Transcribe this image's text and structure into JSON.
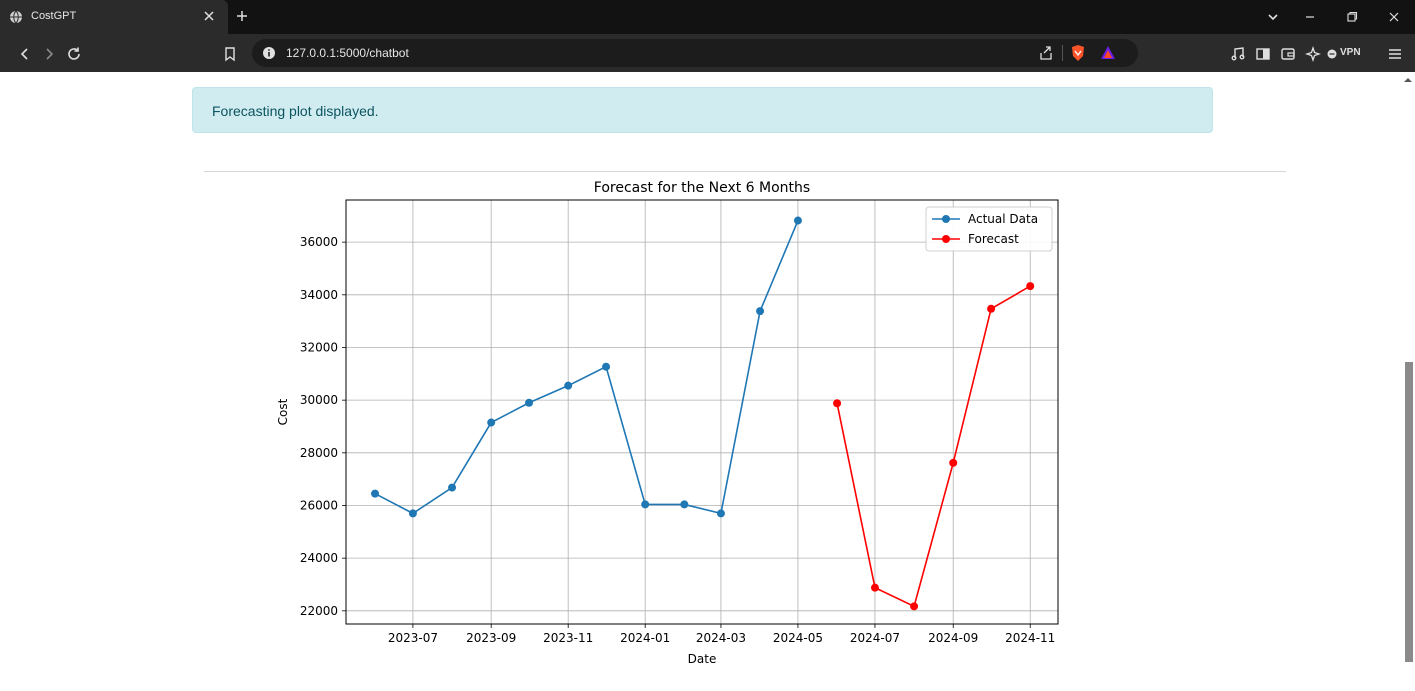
{
  "browser": {
    "tab_title": "CostGPT",
    "url": "127.0.0.1:5000/chatbot",
    "vpn_label": "VPN"
  },
  "alert": {
    "message": "Forecasting plot displayed."
  },
  "chart_data": {
    "type": "line",
    "title": "Forecast for the Next 6 Months",
    "xlabel": "Date",
    "ylabel": "Cost",
    "x_tick_labels": [
      "2023-07",
      "2023-09",
      "2023-11",
      "2024-01",
      "2024-03",
      "2024-05",
      "2024-07",
      "2024-09",
      "2024-11"
    ],
    "y_tick_labels": [
      "22000",
      "24000",
      "26000",
      "28000",
      "30000",
      "32000",
      "34000",
      "36000"
    ],
    "ylim": [
      21500,
      37600
    ],
    "xlim": [
      "2023-05-09",
      "2024-11-23"
    ],
    "grid": true,
    "legend_position": "top-right",
    "series": [
      {
        "name": "Actual Data",
        "color": "#1f77b4",
        "x": [
          "2023-06-01",
          "2023-07-01",
          "2023-08-01",
          "2023-09-01",
          "2023-10-01",
          "2023-11-01",
          "2023-12-01",
          "2024-01-01",
          "2024-02-01",
          "2024-03-01",
          "2024-04-01",
          "2024-05-01"
        ],
        "values": [
          26450,
          25700,
          26680,
          29150,
          29900,
          30550,
          31270,
          26040,
          26040,
          25700,
          33380,
          36820
        ]
      },
      {
        "name": "Forecast",
        "color": "#ff0000",
        "x": [
          "2024-06-01",
          "2024-07-01",
          "2024-08-01",
          "2024-09-01",
          "2024-10-01",
          "2024-11-01"
        ],
        "values": [
          29880,
          22880,
          22170,
          27620,
          33470,
          34330
        ]
      }
    ]
  }
}
